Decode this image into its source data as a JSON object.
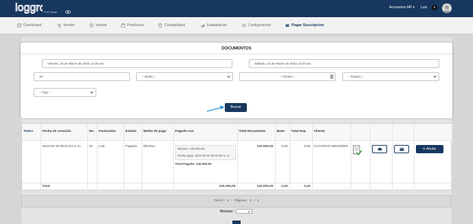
{
  "header": {
    "logo_text": "loggro",
    "logo_subtitle": "POS Tienda",
    "account": "Accesorios MP",
    "user": "Luis",
    "notifications": "0",
    "brand_color": "#17375e"
  },
  "nav": {
    "items": [
      {
        "label": "Dashboard",
        "icon": "dashboard-icon"
      },
      {
        "label": "Vender",
        "icon": "cart-icon"
      },
      {
        "label": "Ventas",
        "icon": "money-icon"
      },
      {
        "label": "Productos",
        "icon": "box-icon"
      },
      {
        "label": "Contabilidad",
        "icon": "calculator-icon"
      },
      {
        "label": "Estadisticas",
        "icon": "chart-icon"
      },
      {
        "label": "Configuración",
        "icon": "gear-icon"
      },
      {
        "label": "Pagar Suscripcion",
        "icon": "card-icon",
        "active": true
      }
    ]
  },
  "modal": {
    "title": "DOCUMENTOS",
    "date_from": "Viernes, 15 de Marzo de 2024 12:00 am",
    "date_to": "Sábado, 16 de Marzo de 2024 12:00 am",
    "number": "15",
    "medio_placeholder": "-- Medio --",
    "cliente_placeholder": "-- Cliente --",
    "estado_placeholder": "-- Estado --",
    "tipo_placeholder": "-- Tipo --",
    "search_label": "Buscar"
  },
  "table": {
    "headers": [
      "Todos",
      "Fecha de creación",
      "No.",
      "Facturador",
      "Estado",
      "Medio de pago",
      "Pagado con",
      "Total Documento",
      "Base",
      "Total Imp.",
      "Cliente"
    ],
    "row": {
      "fecha": "2024-03-15 08:44:04 a. m.",
      "no": "15",
      "facturador": "Luis",
      "estado": "Pagada",
      "medio": "Efectivo",
      "pago_linea1": "Efectivo: 120.000,00",
      "pago_linea2": "Fecha pago: 2024-03-15 08:44:05 a. m.",
      "pago_total": "Total Pagado: 120.000,00",
      "total_documento": "120.000,00",
      "base": "0,00",
      "total_imp": "0,00",
      "cliente": "CUANTIAS MENORES",
      "anular_label": "Anular"
    },
    "totals": {
      "label": "Total",
      "medio_total": "120.000,00",
      "total_documento": "120.000,00",
      "base": "0,00",
      "total_imp": "0,00"
    }
  },
  "pagination": {
    "summary": "Total: 1 - Página: 1 / 1",
    "mostrar_label": "Mostrar:"
  }
}
